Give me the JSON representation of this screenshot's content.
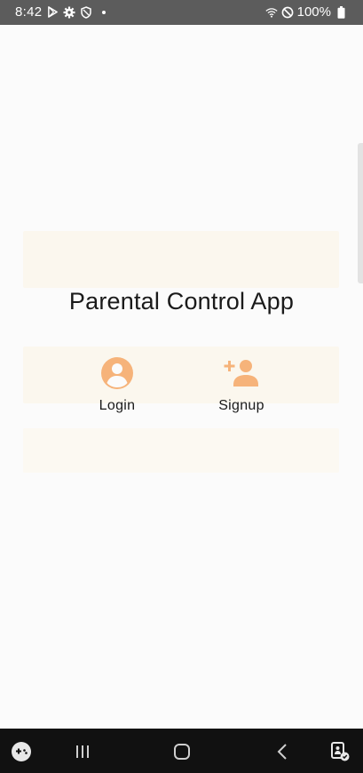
{
  "status_bar": {
    "time": "8:42",
    "battery_text": "100%",
    "left_icons": [
      "play-store-icon",
      "settings-gear-icon",
      "shield-icon",
      "notification-dot-icon"
    ],
    "right_icons": [
      "wifi-icon",
      "do-not-disturb-icon",
      "battery-icon"
    ]
  },
  "app": {
    "title": "Parental Control App",
    "accent_color": "#f6b37a"
  },
  "actions": {
    "login_label": "Login",
    "signup_label": "Signup"
  },
  "nav_bar": {
    "items": [
      "game-launcher-icon",
      "recent-apps-icon",
      "home-icon",
      "back-icon",
      "accessibility-icon"
    ]
  }
}
